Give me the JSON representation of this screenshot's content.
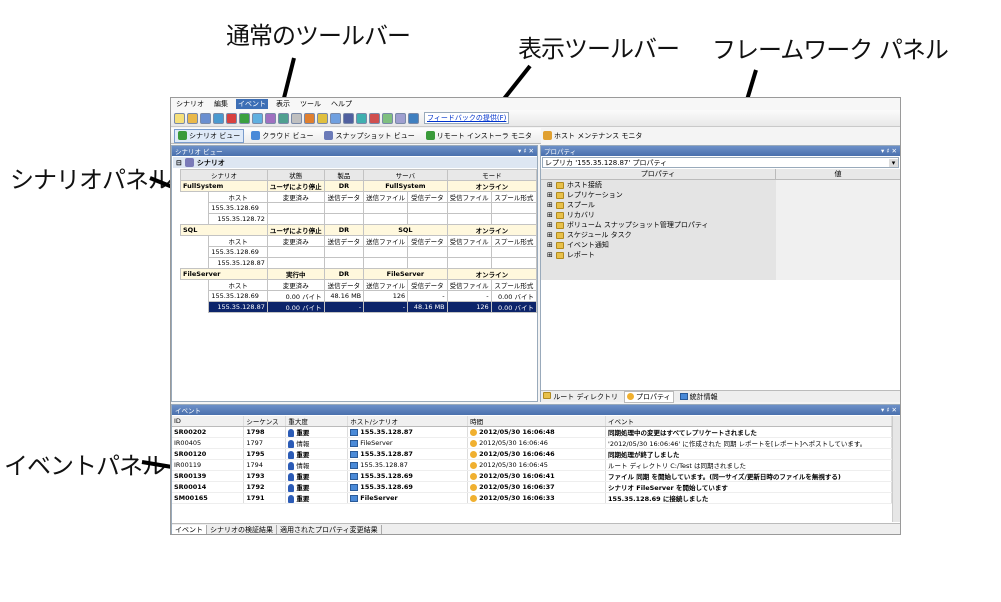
{
  "callouts": {
    "normal_toolbar": "通常のツールバー",
    "view_toolbar": "表示ツールバー",
    "framework_panel": "フレームワーク パネル",
    "scenario_panel": "シナリオパネル",
    "event_panel": "イベントパネル"
  },
  "menu": [
    "シナリオ",
    "編集",
    "イベント",
    "表示",
    "ツール",
    "ヘルプ"
  ],
  "toolbar": {
    "feedback_link": "フィードバックの提供(F)"
  },
  "viewbar": [
    "シナリオ ビュー",
    "クラウド ビュー",
    "スナップショット ビュー",
    "リモート インストーラ モニタ",
    "ホスト メンテナンス モニタ"
  ],
  "scenario_panel": {
    "title": "シナリオ ビュー",
    "controls": "▾ ♯ ✕",
    "root_label": "シナリオ",
    "columns": [
      "シナリオ",
      "状態",
      "製品",
      "サーバ",
      "モード"
    ],
    "sub_columns": [
      "ホスト",
      "変更済み",
      "送信データ",
      "送信ファイル",
      "受信データ",
      "受信ファイル",
      "スプール形式"
    ],
    "scenarios": [
      {
        "name": "FullSystem",
        "state": "ユーザにより停止",
        "product": "DR",
        "server": "FullSystem",
        "mode": "オンライン",
        "hosts": [
          {
            "host": "155.35.128.69",
            "cells": [
              "",
              "",
              "",
              "",
              "",
              ""
            ]
          },
          {
            "host": "155.35.128.72",
            "cells": [
              "",
              "",
              "",
              "",
              "",
              ""
            ]
          }
        ]
      },
      {
        "name": "SQL",
        "state": "ユーザにより停止",
        "product": "DR",
        "server": "SQL",
        "mode": "オンライン",
        "hosts": [
          {
            "host": "155.35.128.69",
            "cells": [
              "",
              "",
              "",
              "",
              "",
              ""
            ]
          },
          {
            "host": "155.35.128.87",
            "cells": [
              "",
              "",
              "",
              "",
              "",
              ""
            ]
          }
        ]
      },
      {
        "name": "FileServer",
        "state": "実行中",
        "product": "DR",
        "server": "FileServer",
        "mode": "オンライン",
        "hosts": [
          {
            "host": "155.35.128.69",
            "cells": [
              "0.00 バイト",
              "48.16 MB",
              "126",
              "-",
              "-",
              "0.00 バイト"
            ]
          },
          {
            "host": "155.35.128.87",
            "cells": [
              "0.00 バイト",
              "-",
              "-",
              "48.16 MB",
              "126",
              "0.00 バイト"
            ]
          }
        ]
      }
    ]
  },
  "properties_panel": {
    "title": "プロパティ",
    "combo": "レプリカ '155.35.128.87' プロパティ",
    "columns": [
      "プロパティ",
      "値"
    ],
    "items": [
      "ホスト接続",
      "レプリケーション",
      "スプール",
      "リカバリ",
      "ボリューム スナップショット管理プロパティ",
      "スケジュール タスク",
      "イベント通知",
      "レポート"
    ],
    "tabs": [
      "ルート ディレクトリ",
      "プロパティ",
      "統計情報"
    ]
  },
  "event_panel": {
    "title": "イベント",
    "columns": [
      "ID",
      "シーケンス",
      "重大度",
      "ホスト/シナリオ",
      "時間",
      "イベント"
    ],
    "rows": [
      {
        "id": "SR00202",
        "seq": "1798",
        "sev": "重要",
        "host": "155.35.128.87",
        "time": "2012/05/30 16:06:48",
        "event": "同期処理中の変更はすべてレプリケートされました",
        "bold": true
      },
      {
        "id": "IR00405",
        "seq": "1797",
        "sev": "情報",
        "host": "FileServer",
        "time": "2012/05/30 16:06:46",
        "event": "'2012/05/30 16:06:46' に作成された 同期 レポートを[レポート]へポストしています。",
        "bold": false
      },
      {
        "id": "SR00120",
        "seq": "1795",
        "sev": "重要",
        "host": "155.35.128.87",
        "time": "2012/05/30 16:06:46",
        "event": "同期処理が終了しました",
        "bold": true
      },
      {
        "id": "IR00119",
        "seq": "1794",
        "sev": "情報",
        "host": "155.35.128.87",
        "time": "2012/05/30 16:06:45",
        "event": "ルート ディレクトリ C:/Test は同期されました",
        "bold": false
      },
      {
        "id": "SR00139",
        "seq": "1793",
        "sev": "重要",
        "host": "155.35.128.69",
        "time": "2012/05/30 16:06:41",
        "event": "ファイル 同期 を開始しています。(同一サイズ/更新日時のファイルを無視する)",
        "bold": true
      },
      {
        "id": "SR00014",
        "seq": "1792",
        "sev": "重要",
        "host": "155.35.128.69",
        "time": "2012/05/30 16:06:37",
        "event": "シナリオ FileServer を開始しています",
        "bold": true
      },
      {
        "id": "SM00165",
        "seq": "1791",
        "sev": "重要",
        "host": "FileServer",
        "time": "2012/05/30 16:06:33",
        "event": "155.35.128.69 に接続しました",
        "bold": true
      }
    ],
    "tabs": [
      "イベント",
      "シナリオの検証結果",
      "適用されたプロパティ変更結果"
    ]
  }
}
